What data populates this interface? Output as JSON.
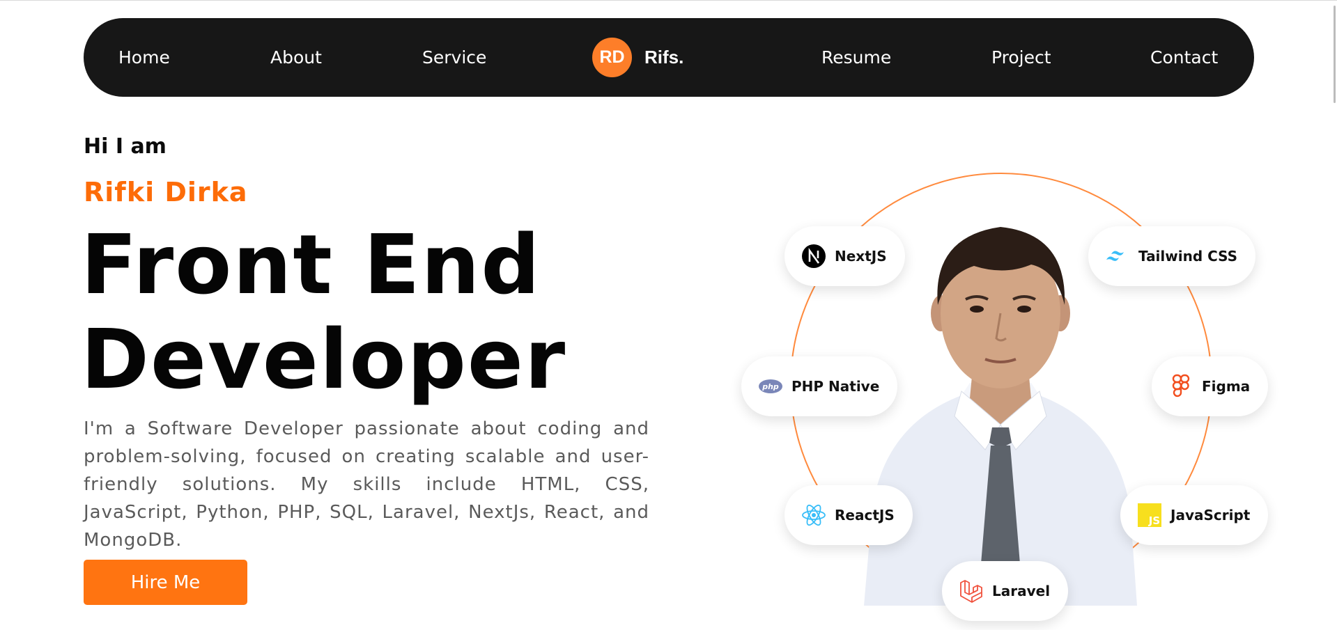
{
  "nav": {
    "links_left": [
      "Home",
      "About",
      "Service"
    ],
    "links_right": [
      "Resume",
      "Project",
      "Contact"
    ],
    "brand_badge": "RD",
    "brand_name": "Rifs."
  },
  "hero": {
    "greeting": "Hi I am",
    "name": "Rifki Dirka",
    "role_line1": "Front End",
    "role_line2": "Developer",
    "bio": "I'm a Software Developer passionate about coding and problem-solving, focused on creating scalable and user-friendly solutions. My skills include HTML, CSS, JavaScript, Python, PHP, SQL, Laravel, NextJs, React, and MongoDB.",
    "cta": "Hire Me"
  },
  "skills": [
    {
      "label": "NextJS",
      "icon": "nextjs-icon"
    },
    {
      "label": "Tailwind CSS",
      "icon": "tailwind-icon"
    },
    {
      "label": "PHP Native",
      "icon": "php-icon"
    },
    {
      "label": "Figma",
      "icon": "figma-icon"
    },
    {
      "label": "ReactJS",
      "icon": "react-icon"
    },
    {
      "label": "JavaScript",
      "icon": "javascript-icon"
    },
    {
      "label": "Laravel",
      "icon": "laravel-icon"
    }
  ],
  "colors": {
    "accent": "#fd6c08",
    "button": "#ff7411",
    "navbar": "#171717",
    "orbit": "#ff8a3d"
  }
}
